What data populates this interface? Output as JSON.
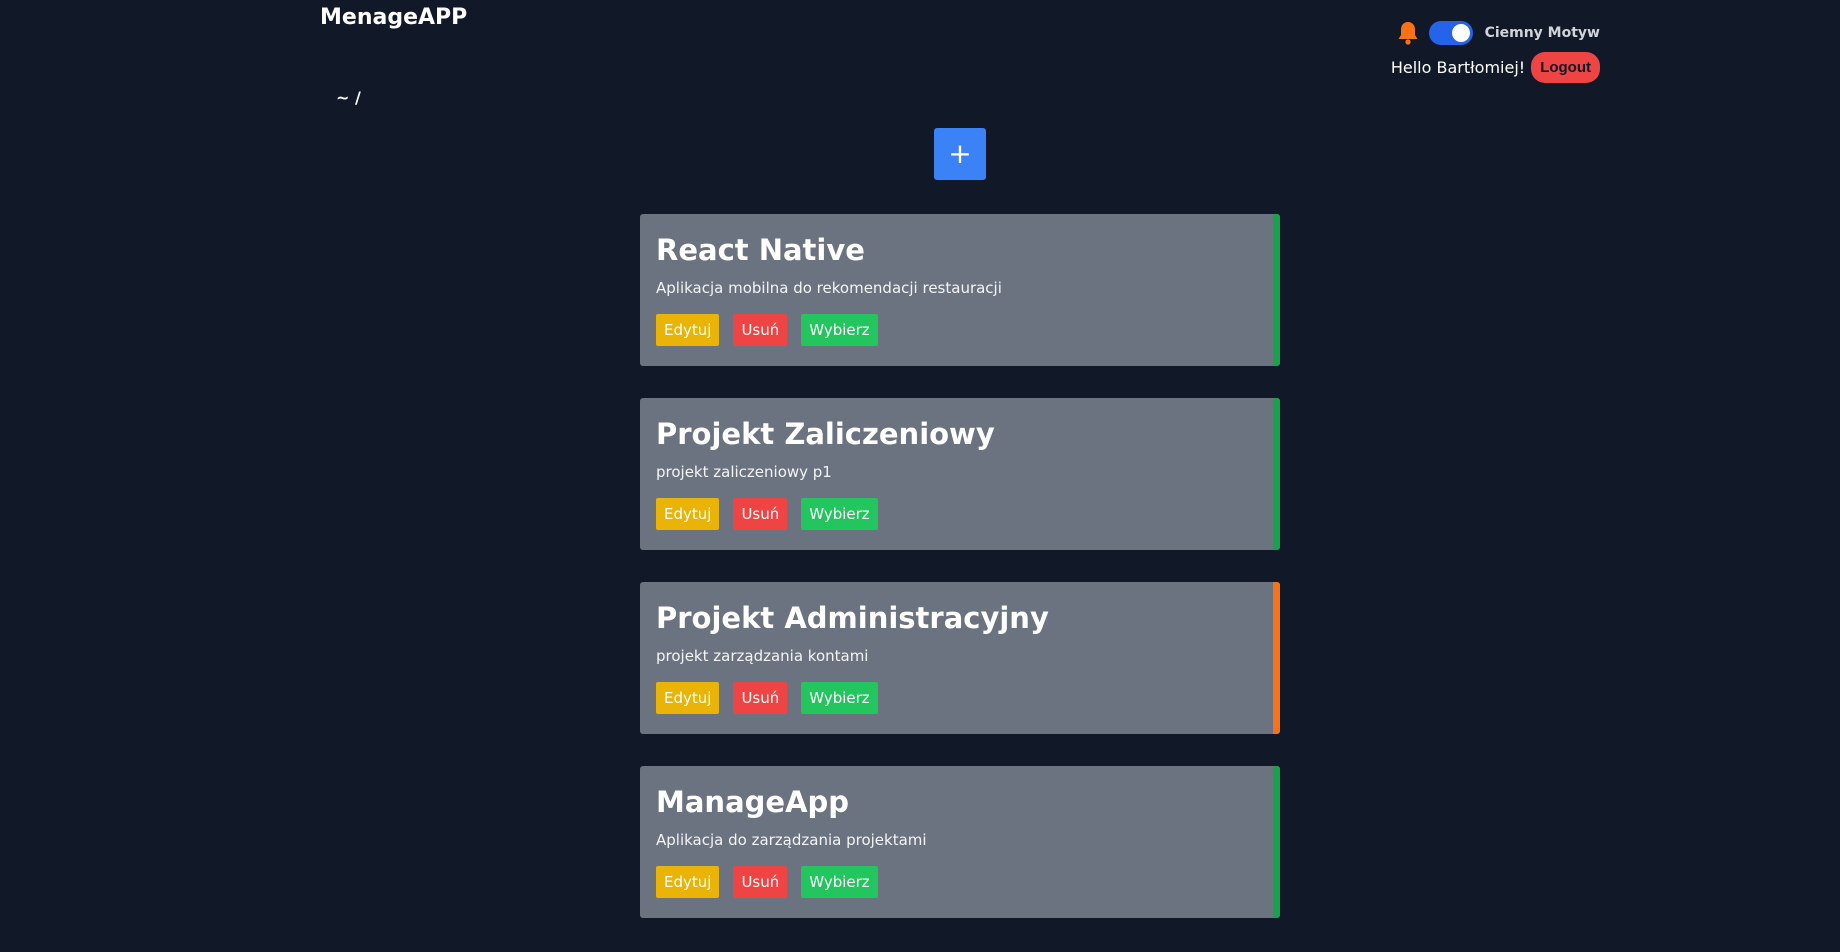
{
  "header": {
    "brand": "MenageAPP",
    "theme_label": "Ciemny Motyw",
    "greeting": "Hello Bartłomiej!",
    "logout_label": "Logout",
    "bell_icon": "bell-icon",
    "bell_color": "#f97316",
    "toggle_on": true
  },
  "breadcrumb": "~ /",
  "add_button": {
    "label": "+",
    "icon": "plus-icon"
  },
  "projects": [
    {
      "title": "React Native",
      "description": "Aplikacja mobilna do rekomendacji restauracji",
      "accent": "#16a34a",
      "edit_label": "Edytuj",
      "delete_label": "Usuń",
      "select_label": "Wybierz"
    },
    {
      "title": "Projekt Zaliczeniowy",
      "description": "projekt zaliczeniowy p1",
      "accent": "#16a34a",
      "edit_label": "Edytuj",
      "delete_label": "Usuń",
      "select_label": "Wybierz"
    },
    {
      "title": "Projekt Administracyjny",
      "description": "projekt zarządzania kontami",
      "accent": "#f97316",
      "edit_label": "Edytuj",
      "delete_label": "Usuń",
      "select_label": "Wybierz"
    },
    {
      "title": "ManageApp",
      "description": "Aplikacja do zarządzania projektami",
      "accent": "#16a34a",
      "edit_label": "Edytuj",
      "delete_label": "Usuń",
      "select_label": "Wybierz"
    }
  ],
  "colors": {
    "background": "#111827",
    "card": "#6b7280",
    "primary": "#3b82f6",
    "edit": "#eab308",
    "delete": "#ef4444",
    "select": "#22c55e"
  }
}
